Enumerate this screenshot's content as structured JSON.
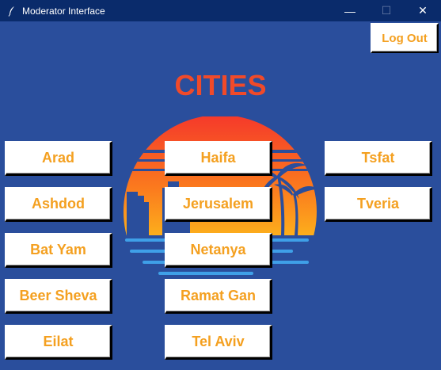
{
  "window": {
    "title": "Moderator Interface",
    "controls": {
      "minimize": "—",
      "maximize": "☐",
      "close": "✕"
    }
  },
  "header": {
    "logout_label": "Log Out"
  },
  "heading": "CITIES",
  "colors": {
    "background": "#2a4e9c",
    "titlebar": "#0a2b6b",
    "heading": "#f04a2a",
    "button_text": "#f4a020",
    "button_bg": "#ffffff"
  },
  "cities": {
    "col1": [
      "Arad",
      "Ashdod",
      "Bat Yam",
      "Beer Sheva",
      "Eilat"
    ],
    "col2": [
      "Haifa",
      "Jerusalem",
      "Netanya",
      "Ramat Gan",
      "Tel Aviv"
    ],
    "col3": [
      "Tsfat",
      "Tveria"
    ]
  },
  "logo": {
    "icon": "sunset-city-icon"
  }
}
